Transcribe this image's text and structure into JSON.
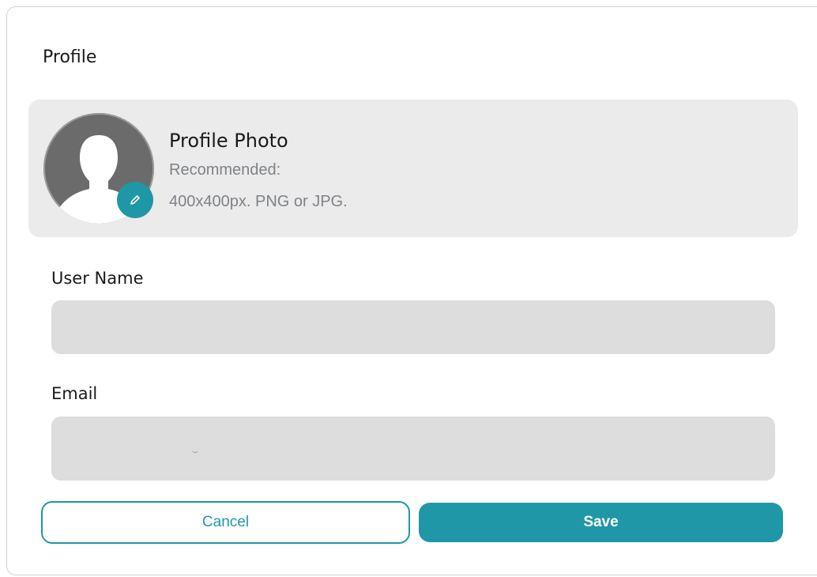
{
  "header": {
    "title": "Profile"
  },
  "profile_photo": {
    "heading": "Profile Photo",
    "hint_line1": "Recommended:",
    "hint_line2": "400x400px. PNG or JPG.",
    "avatar_icon": "user-silhouette-icon",
    "edit_icon": "pencil-icon"
  },
  "form": {
    "user_name": {
      "label": "User Name",
      "value": "",
      "placeholder": ""
    },
    "email": {
      "label": "Email",
      "value": "",
      "placeholder": ""
    }
  },
  "actions": {
    "cancel_label": "Cancel",
    "save_label": "Save"
  },
  "colors": {
    "accent": "#1f97a6",
    "panel": "#ebebeb",
    "input_bg": "#dddddd",
    "hint_text": "#7f8288"
  }
}
